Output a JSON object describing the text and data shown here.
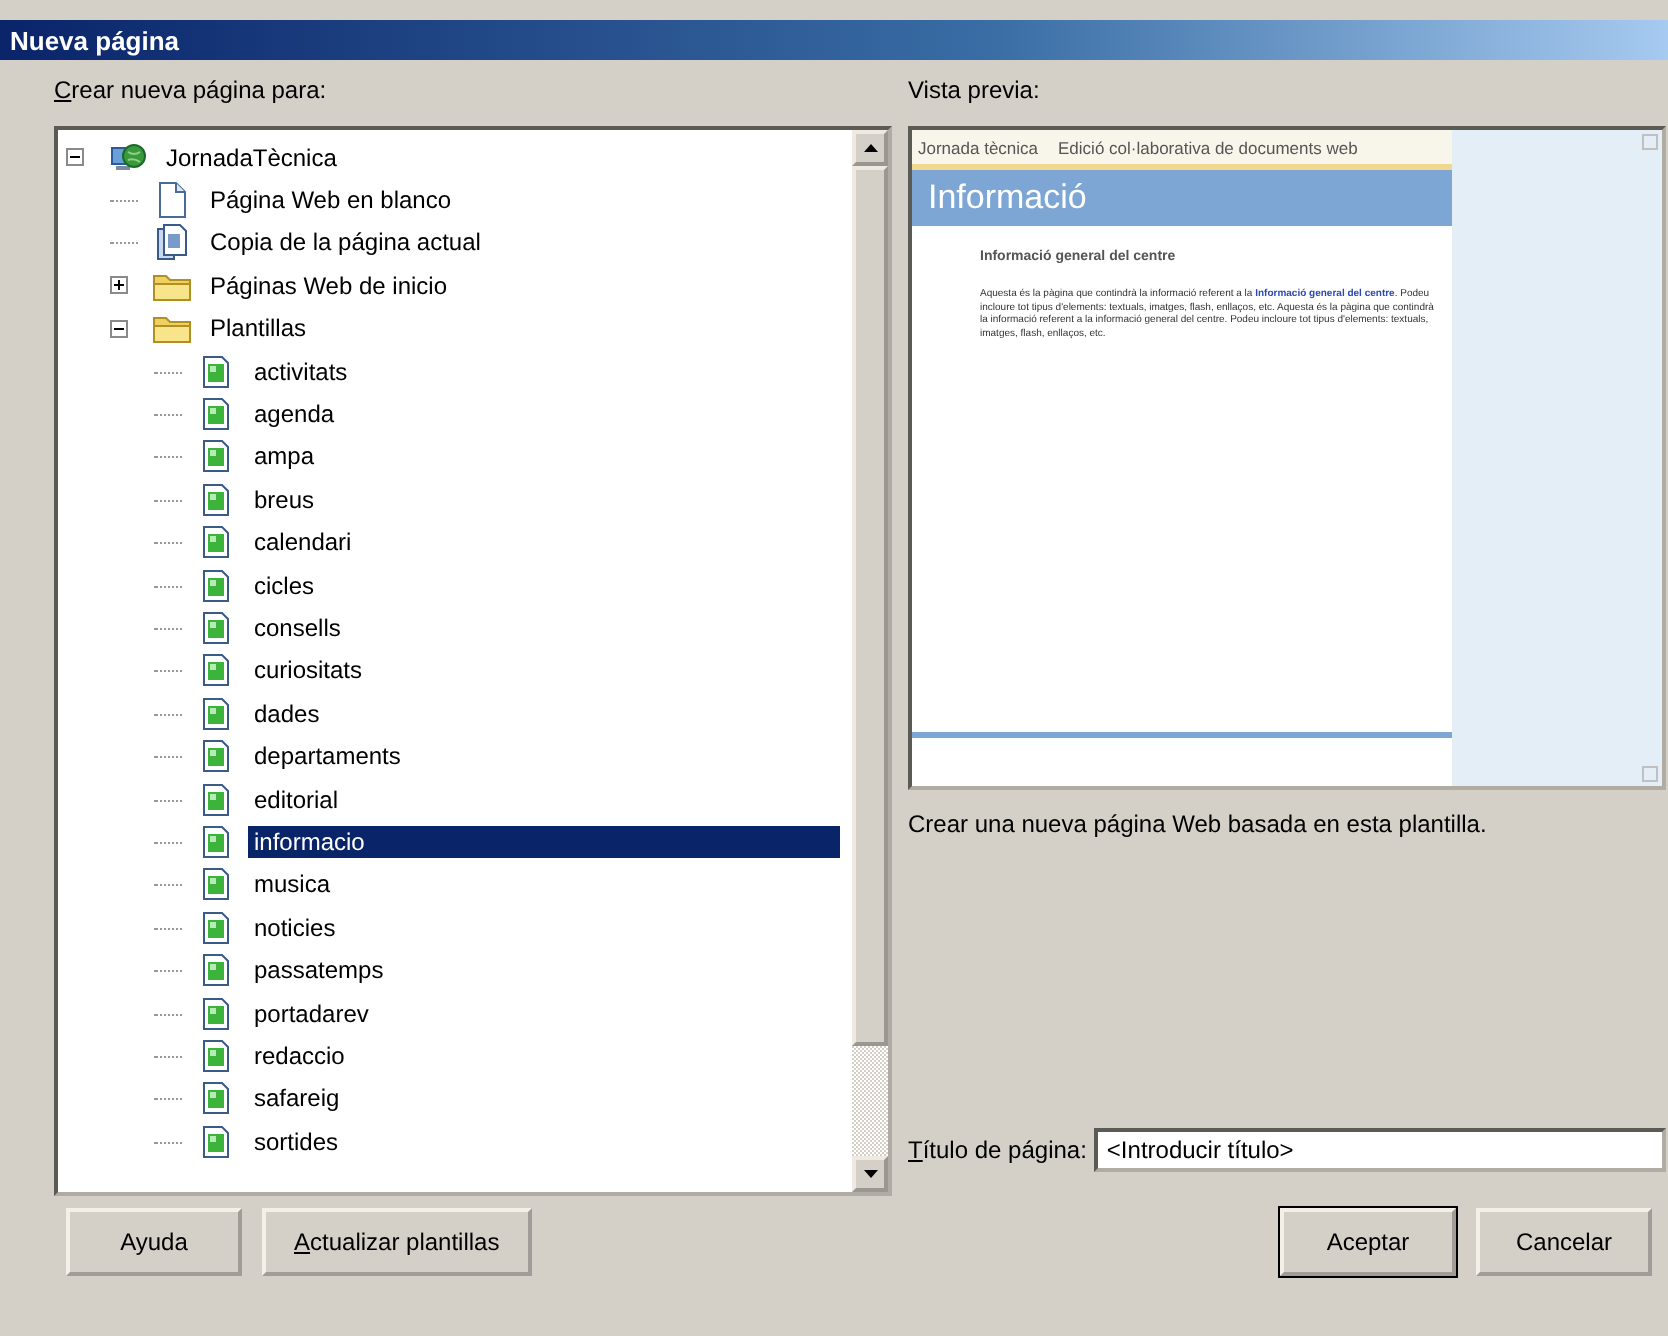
{
  "window": {
    "title": "Nueva página"
  },
  "tree": {
    "label": "Crear nueva página para:",
    "items": [
      {
        "label": "JornadaTècnica",
        "kind": "site",
        "expanded": true,
        "children": [
          {
            "label": "Página Web en blanco",
            "kind": "page"
          },
          {
            "label": "Copia de la página actual",
            "kind": "copy"
          },
          {
            "label": "Páginas Web de inicio",
            "kind": "folder",
            "expanded": false
          },
          {
            "label": "Plantillas",
            "kind": "folder",
            "expanded": true,
            "children": [
              {
                "label": "activitats",
                "kind": "template",
                "selected": false
              },
              {
                "label": "agenda",
                "kind": "template",
                "selected": false
              },
              {
                "label": "ampa",
                "kind": "template",
                "selected": false
              },
              {
                "label": "breus",
                "kind": "template",
                "selected": false
              },
              {
                "label": "calendari",
                "kind": "template",
                "selected": false
              },
              {
                "label": "cicles",
                "kind": "template",
                "selected": false
              },
              {
                "label": "consells",
                "kind": "template",
                "selected": false
              },
              {
                "label": "curiositats",
                "kind": "template",
                "selected": false
              },
              {
                "label": "dades",
                "kind": "template",
                "selected": false
              },
              {
                "label": "departaments",
                "kind": "template",
                "selected": false
              },
              {
                "label": "editorial",
                "kind": "template",
                "selected": false
              },
              {
                "label": "informacio",
                "kind": "template",
                "selected": true
              },
              {
                "label": "musica",
                "kind": "template",
                "selected": false
              },
              {
                "label": "noticies",
                "kind": "template",
                "selected": false
              },
              {
                "label": "passatemps",
                "kind": "template",
                "selected": false
              },
              {
                "label": "portadarev",
                "kind": "template",
                "selected": false
              },
              {
                "label": "redaccio",
                "kind": "template",
                "selected": false
              },
              {
                "label": "safareig",
                "kind": "template",
                "selected": false
              },
              {
                "label": "sortides",
                "kind": "template",
                "selected": false
              }
            ]
          }
        ]
      }
    ]
  },
  "preview": {
    "label": "Vista previa:",
    "site_name": "Jornada tècnica",
    "site_subtitle": "Edició col·laborativa de documents web",
    "page_title": "Informació",
    "heading": "Informació general del centre",
    "body_before": "Aquesta és la pàgina que contindrà la informació referent a la",
    "body_link": "Informació general del centre",
    "body_after": ". Podeu incloure tot tipus d'elements: textuals, imatges, flash, enllaços, etc. Aquesta és la pàgina que contindrà la informació referent a la informació general del centre. Podeu incloure tot tipus d'elements: textuals, imatges, flash, enllaços, etc.",
    "description": "Crear una nueva página Web basada en esta plantilla."
  },
  "page_title_field": {
    "label": "Título de página:",
    "value": "<Introducir título>"
  },
  "buttons": [
    {
      "label": "Ayuda",
      "kind": "help"
    },
    {
      "label": "Actualizar plantillas",
      "kind": "update"
    },
    {
      "label": "Aceptar",
      "kind": "ok",
      "default": true
    },
    {
      "label": "Cancelar",
      "kind": "cancel",
      "default": false
    }
  ]
}
